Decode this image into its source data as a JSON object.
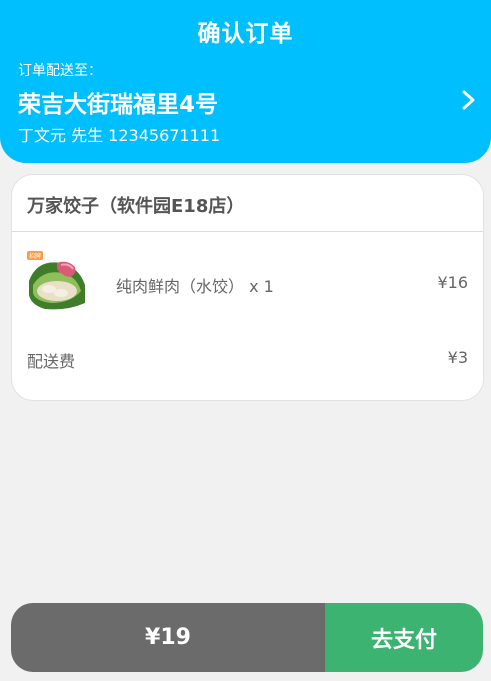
{
  "header": {
    "title": "确认订单",
    "deliver_to_label": "订单配送至：",
    "address": "荣吉大街瑞福里4号",
    "contact": "丁文元 先生 12345671111",
    "arrow_icon": "chevron-right-icon"
  },
  "order": {
    "shop_name": "万家饺子（软件园E18店）",
    "items": [
      {
        "name": "纯肉鲜肉（水饺） x 1",
        "price": "¥16",
        "thumb_badge": "招牌"
      }
    ],
    "delivery_fee_label": "配送费",
    "delivery_fee": "¥3"
  },
  "footer": {
    "total": "¥19",
    "pay_label": "去支付"
  },
  "colors": {
    "header_bg": "#00bfff",
    "pay_button": "#3cb371",
    "total_bg": "#6b6b6b",
    "page_bg": "#f1f1f1"
  }
}
